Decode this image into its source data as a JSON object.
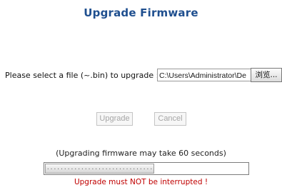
{
  "page": {
    "title": "Upgrade Firmware"
  },
  "file_select": {
    "label": "Please select a file (~.bin) to upgrade :",
    "path_value": "C:\\Users\\Administrator\\De",
    "browse_label": "浏览..."
  },
  "buttons": {
    "upgrade_label": "Upgrade",
    "cancel_label": "Cancel",
    "upgrade_enabled": false,
    "cancel_enabled": false
  },
  "progress": {
    "note": "(Upgrading firmware may take 60 seconds)",
    "fill_fraction": 0.54,
    "fill_pattern": "..............................."
  },
  "warning": {
    "text": "Upgrade must NOT be interrupted !"
  },
  "colors": {
    "title": "#1f4f8f",
    "warning": "#c00000",
    "disabled_text": "#a6a6a6"
  }
}
